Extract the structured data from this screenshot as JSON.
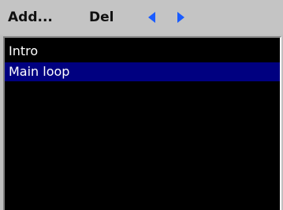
{
  "toolbar": {
    "add_label": "Add...",
    "del_label": "Del",
    "prev_icon": "arrow-left-icon",
    "next_icon": "arrow-right-icon",
    "arrow_color": "#1a5cff",
    "background_color": "#c4c4c4"
  },
  "list": {
    "background_color": "#000000",
    "text_color": "#ffffff",
    "selected_color": "#000080",
    "selected_index": 1,
    "items": [
      {
        "label": "Intro"
      },
      {
        "label": "Main loop"
      }
    ]
  }
}
